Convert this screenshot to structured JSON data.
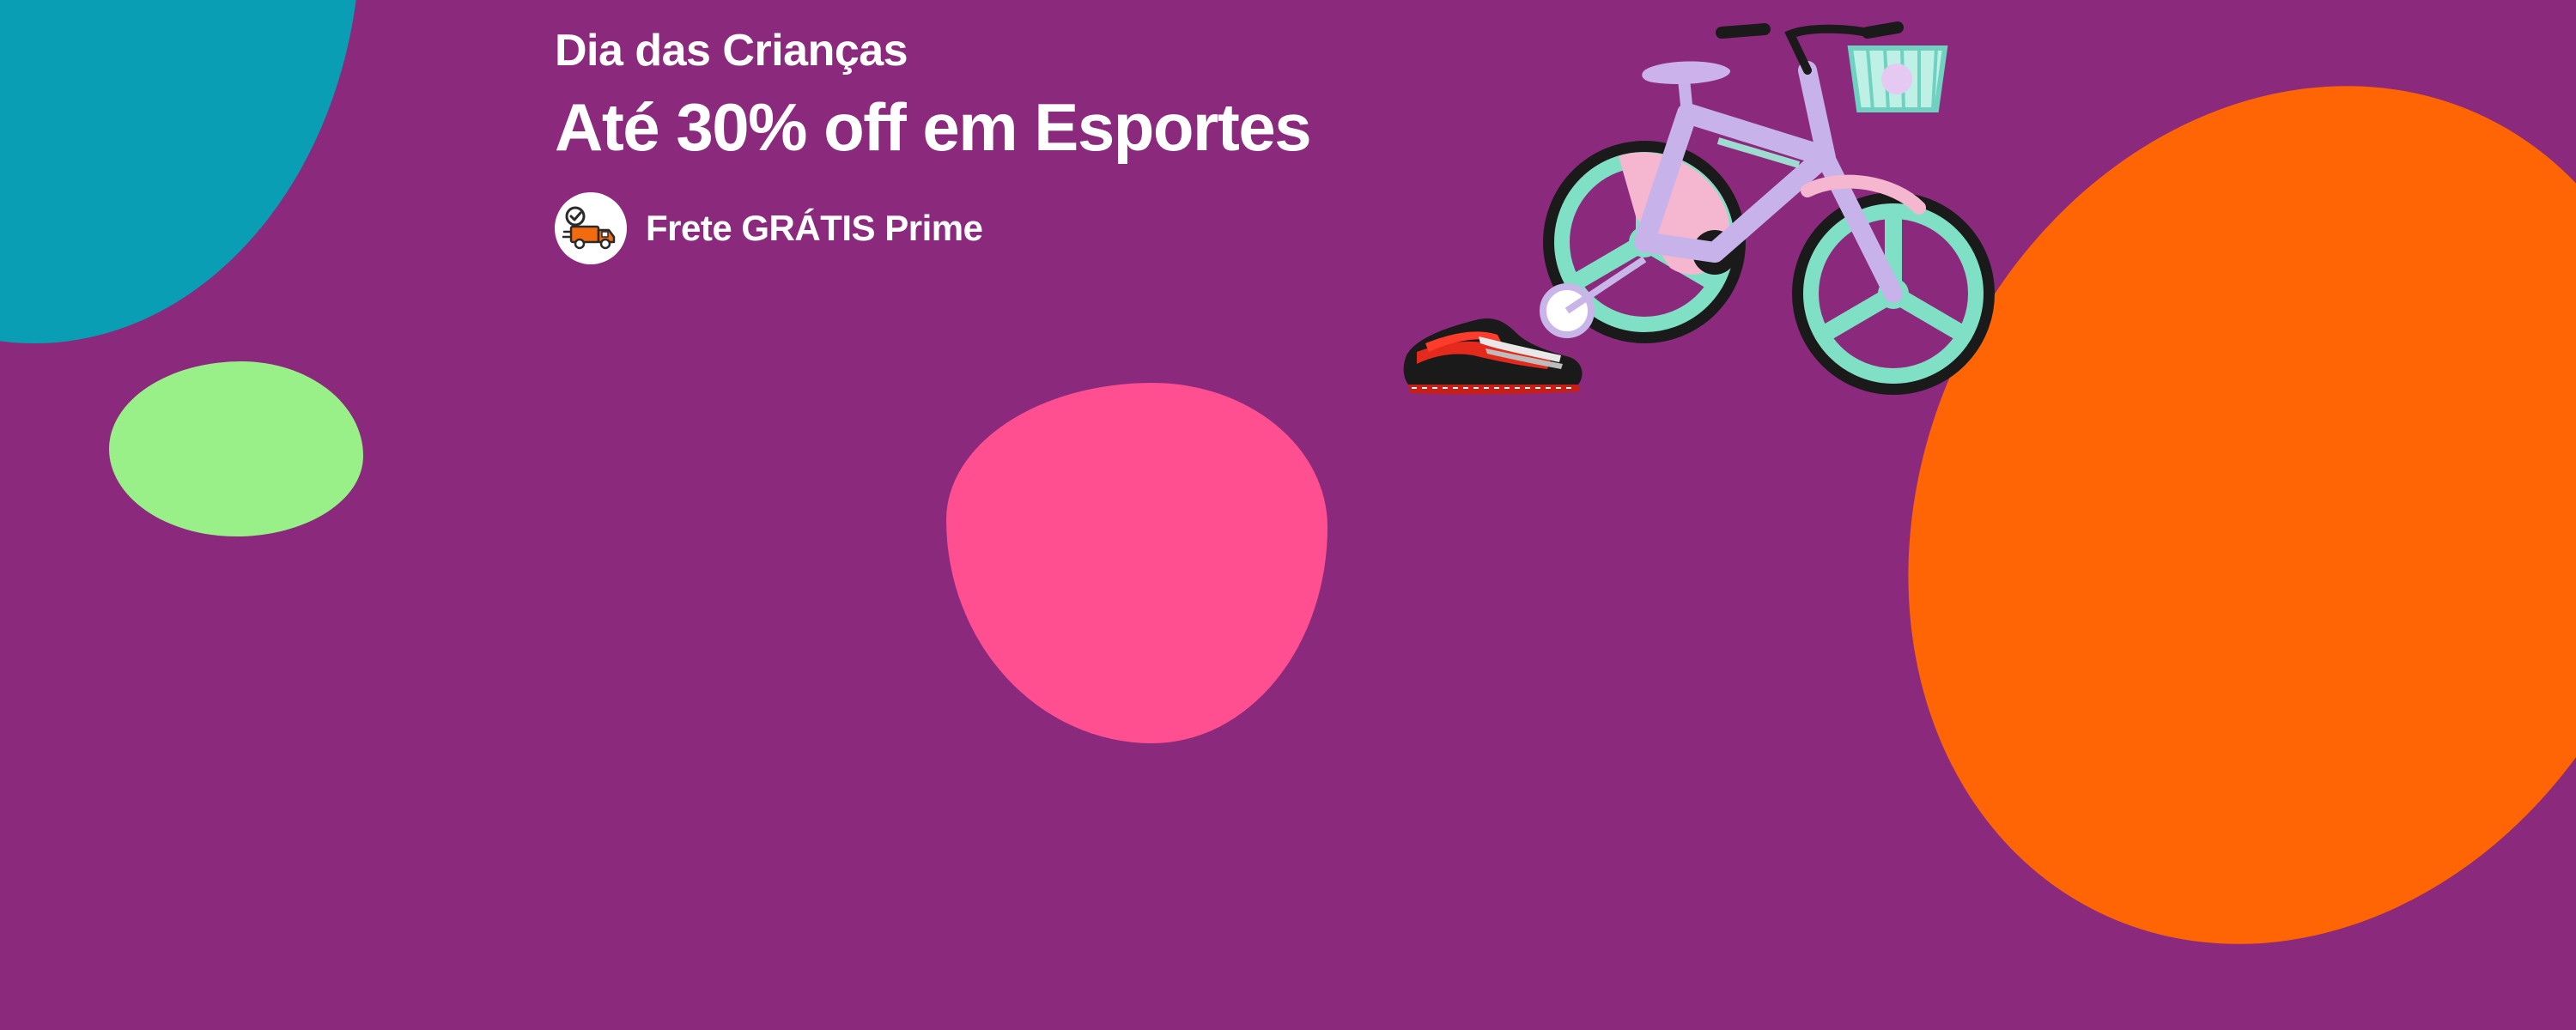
{
  "banner": {
    "eyebrow": "Dia das Crianças",
    "headline": "Até 30% off em Esportes",
    "shipping_text": "Frete GRÁTIS Prime",
    "shipping_icon": "delivery-truck-icon",
    "products": [
      "kids-bicycle",
      "sneaker"
    ]
  },
  "colors": {
    "background": "#8b2a7c",
    "blob_teal": "#0a9eb4",
    "blob_green": "#99ef88",
    "blob_pink": "#ff4f91",
    "blob_orange": "#ff6405",
    "text": "#ffffff",
    "truck": "#f26b0f"
  }
}
